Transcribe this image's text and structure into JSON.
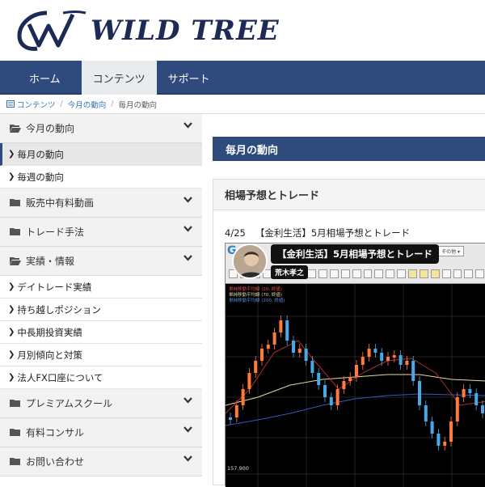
{
  "header": {
    "logo_text": "WILD TREE"
  },
  "nav": {
    "items": [
      "ホーム",
      "コンテンツ",
      "サポート"
    ],
    "active": "コンテンツ"
  },
  "breadcrumb": {
    "items": [
      "コンテンツ",
      "今月の動向",
      "毎月の動向"
    ]
  },
  "sidebar": {
    "cat_monthly": "今月の動向",
    "item_monthly": "毎月の動向",
    "item_weekly": "毎週の動向",
    "cat_video": "販売中有料動画",
    "cat_trade": "トレード手法",
    "cat_results": "実績・情報",
    "results_items": [
      "デイトレード実績",
      "持ち越しポジション",
      "中長期投資実績",
      "月別傾向と対策",
      "法人FX口座について"
    ],
    "cat_premium": "プレミアムスクール",
    "cat_consult": "有料コンサル",
    "cat_contact": "お問い合わせ"
  },
  "main": {
    "page_title": "毎月の動向",
    "panel_title": "相場予想とトレード",
    "post_date": "4/25",
    "post_title": "【金利生活】5月相場予想とトレード",
    "video_title": "【金利生活】5月相場予想とトレード",
    "video_author": "荒木孝之",
    "toolbar_dropdown": "その他 ▾",
    "price_label": "157.900",
    "legend": [
      "単純移動平均線 (20, 終値)",
      "単純移動平均線 (70, 終値)",
      "単純移動平均線 (200, 終値)"
    ]
  },
  "colors": {
    "nav_bg": "#2f4b7e",
    "logo": "#1d2a55",
    "link": "#2f6fb1",
    "candle_up": "#ff7a3c",
    "candle_down": "#4aa8e8"
  }
}
